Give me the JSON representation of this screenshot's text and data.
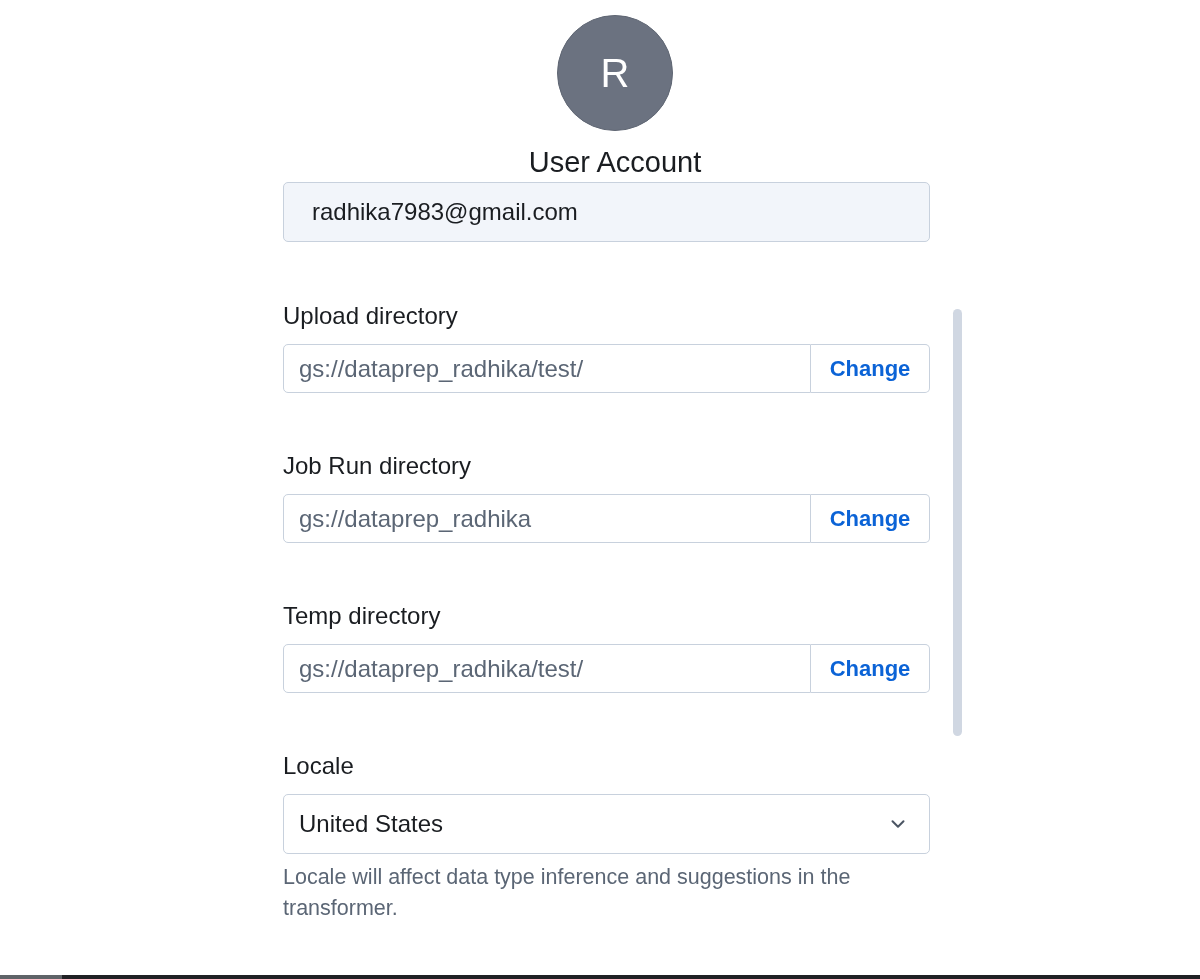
{
  "avatar": {
    "initial": "R"
  },
  "title": "User Account",
  "email": {
    "value": "radhika7983@gmail.com",
    "readonly": true
  },
  "directories": [
    {
      "label": "Upload directory",
      "value": "gs://dataprep_radhika/test/",
      "button": "Change"
    },
    {
      "label": "Job Run directory",
      "value": "gs://dataprep_radhika",
      "button": "Change"
    },
    {
      "label": "Temp directory",
      "value": "gs://dataprep_radhika/test/",
      "button": "Change"
    }
  ],
  "locale": {
    "label": "Locale",
    "value": "United States",
    "help": "Locale will affect data type inference and suggestions in the transformer."
  }
}
